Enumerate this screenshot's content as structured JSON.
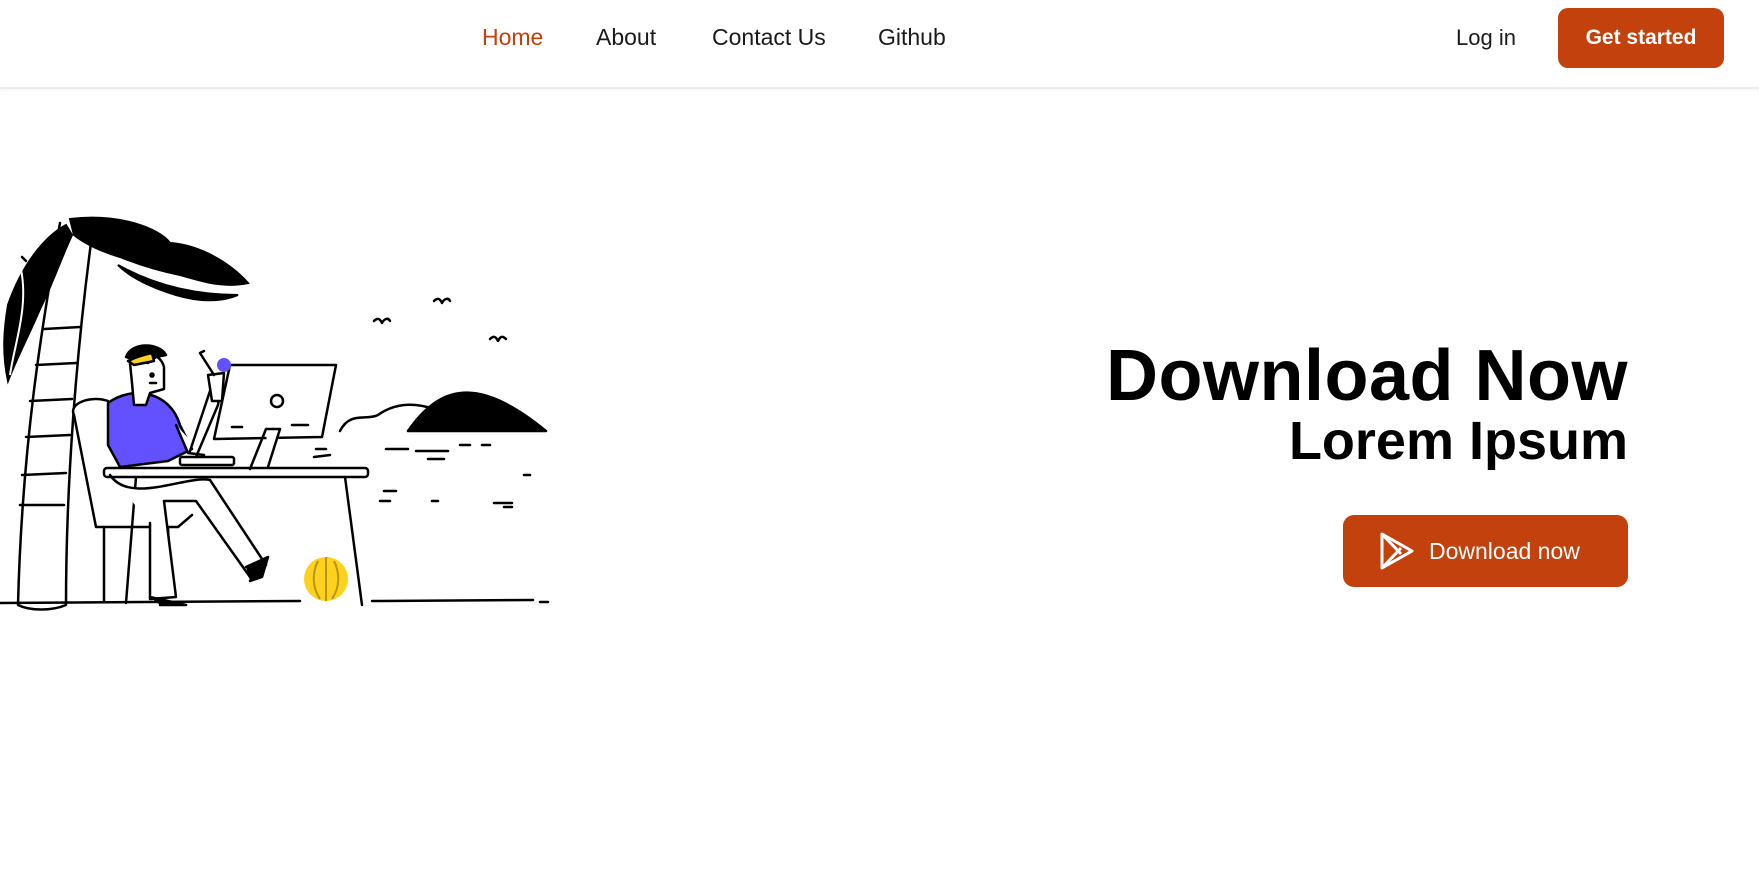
{
  "nav": {
    "items": [
      {
        "label": "Home",
        "active": true
      },
      {
        "label": "About",
        "active": false
      },
      {
        "label": "Contact Us",
        "active": false
      },
      {
        "label": "Github",
        "active": false
      }
    ],
    "login_label": "Log in",
    "cta_label": "Get started"
  },
  "hero": {
    "title": "Download Now",
    "subtitle": "Lorem Ipsum",
    "download_label": "Download now",
    "download_icon": "play-store-icon",
    "illustration": "person-working-at-desk-on-beach-illustration"
  },
  "colors": {
    "accent": "#c2410c",
    "illustration_purple": "#6350ff",
    "illustration_yellow": "#fcd21f",
    "text": "#000000",
    "background": "#ffffff"
  }
}
